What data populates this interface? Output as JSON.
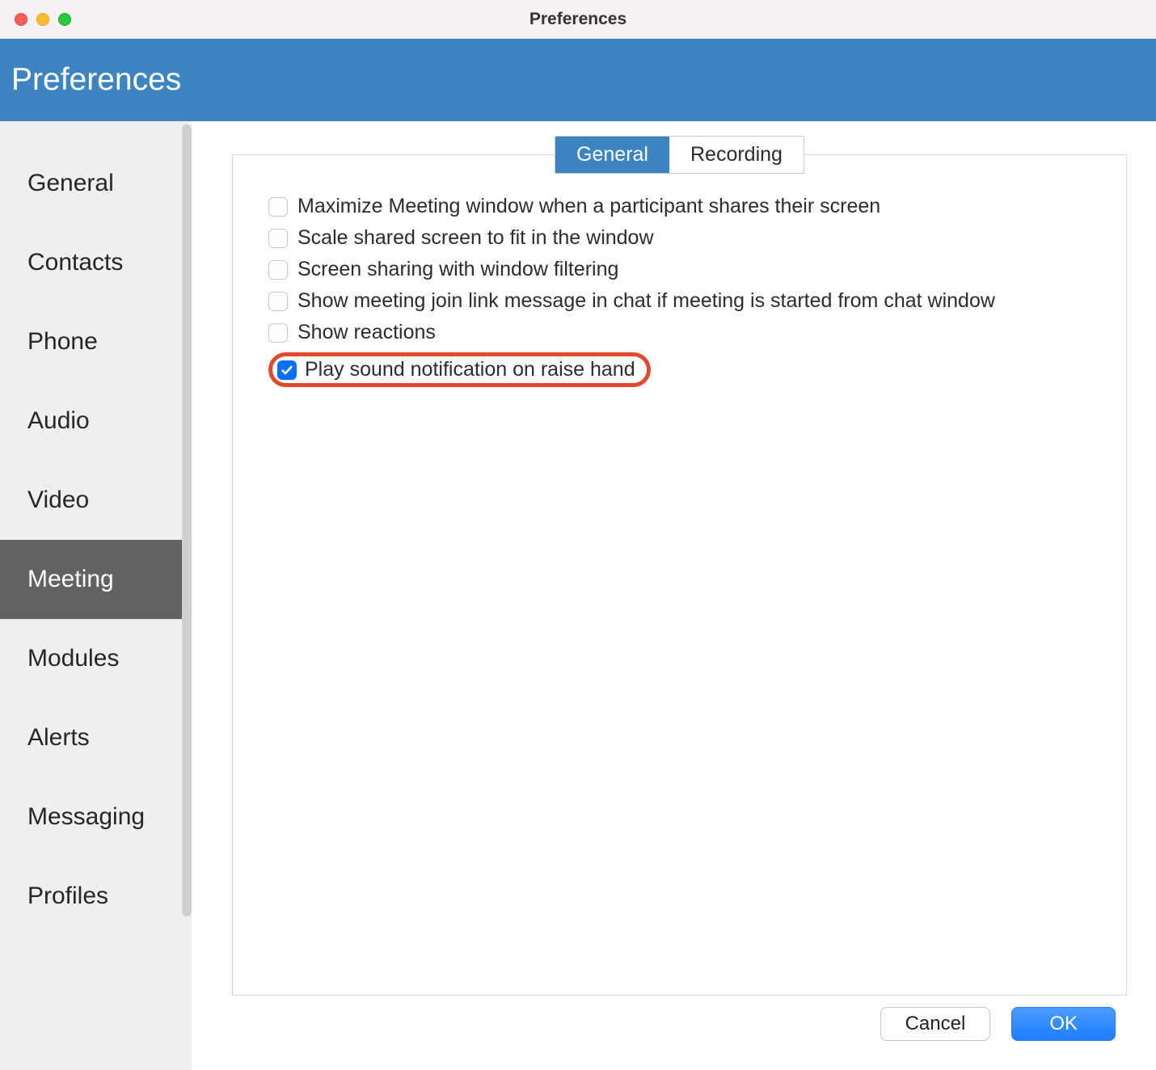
{
  "window": {
    "title": "Preferences"
  },
  "header": {
    "title": "Preferences"
  },
  "sidebar": {
    "items": [
      {
        "label": "General",
        "active": false,
        "key": "general"
      },
      {
        "label": "Contacts",
        "active": false,
        "key": "contacts"
      },
      {
        "label": "Phone",
        "active": false,
        "key": "phone"
      },
      {
        "label": "Audio",
        "active": false,
        "key": "audio"
      },
      {
        "label": "Video",
        "active": false,
        "key": "video"
      },
      {
        "label": "Meeting",
        "active": true,
        "key": "meeting"
      },
      {
        "label": "Modules",
        "active": false,
        "key": "modules"
      },
      {
        "label": "Alerts",
        "active": false,
        "key": "alerts"
      },
      {
        "label": "Messaging",
        "active": false,
        "key": "messaging"
      },
      {
        "label": "Profiles",
        "active": false,
        "key": "profiles"
      }
    ]
  },
  "tabs": [
    {
      "label": "General",
      "active": true,
      "key": "general"
    },
    {
      "label": "Recording",
      "active": false,
      "key": "recording"
    }
  ],
  "options": [
    {
      "label": "Maximize Meeting window when a participant shares their screen",
      "checked": false,
      "highlighted": false,
      "key": "maximize-on-share"
    },
    {
      "label": "Scale shared screen to fit in the window",
      "checked": false,
      "highlighted": false,
      "key": "scale-shared-screen"
    },
    {
      "label": "Screen sharing with window filtering",
      "checked": false,
      "highlighted": false,
      "key": "window-filtering"
    },
    {
      "label": "Show meeting join link message in chat if meeting is started from chat window",
      "checked": false,
      "highlighted": false,
      "key": "join-link-chat"
    },
    {
      "label": "Show reactions",
      "checked": false,
      "highlighted": false,
      "key": "show-reactions"
    },
    {
      "label": "Play sound notification on raise hand",
      "checked": true,
      "highlighted": true,
      "key": "raise-hand-sound"
    }
  ],
  "footer": {
    "cancel_label": "Cancel",
    "ok_label": "OK"
  }
}
